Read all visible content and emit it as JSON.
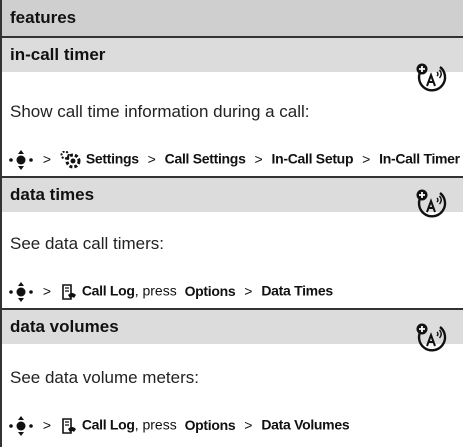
{
  "header": {
    "title": "features"
  },
  "sections": [
    {
      "title": "in-call timer",
      "description": "Show call time information during a call:",
      "path": {
        "sep": ">",
        "step1": "Settings",
        "step2": "Call Settings",
        "step3": "In-Call Setup",
        "step4": "In-Call Timer"
      },
      "icons": [
        "nav-key-icon",
        "settings-icon",
        "network-feature-icon"
      ]
    },
    {
      "title": "data times",
      "description": "See data call timers:",
      "path": {
        "sep": ">",
        "step1": "Call Log",
        "press": ", press",
        "step2": "Options",
        "step3": "Data Times"
      },
      "icons": [
        "nav-key-icon",
        "call-log-icon",
        "network-feature-icon"
      ]
    },
    {
      "title": "data volumes",
      "description": "See data volume meters:",
      "path": {
        "sep": ">",
        "step1": "Call Log",
        "press": ", press",
        "step2": "Options",
        "step3": "Data Volumes"
      },
      "icons": [
        "nav-key-icon",
        "call-log-icon",
        "network-feature-icon"
      ]
    }
  ]
}
